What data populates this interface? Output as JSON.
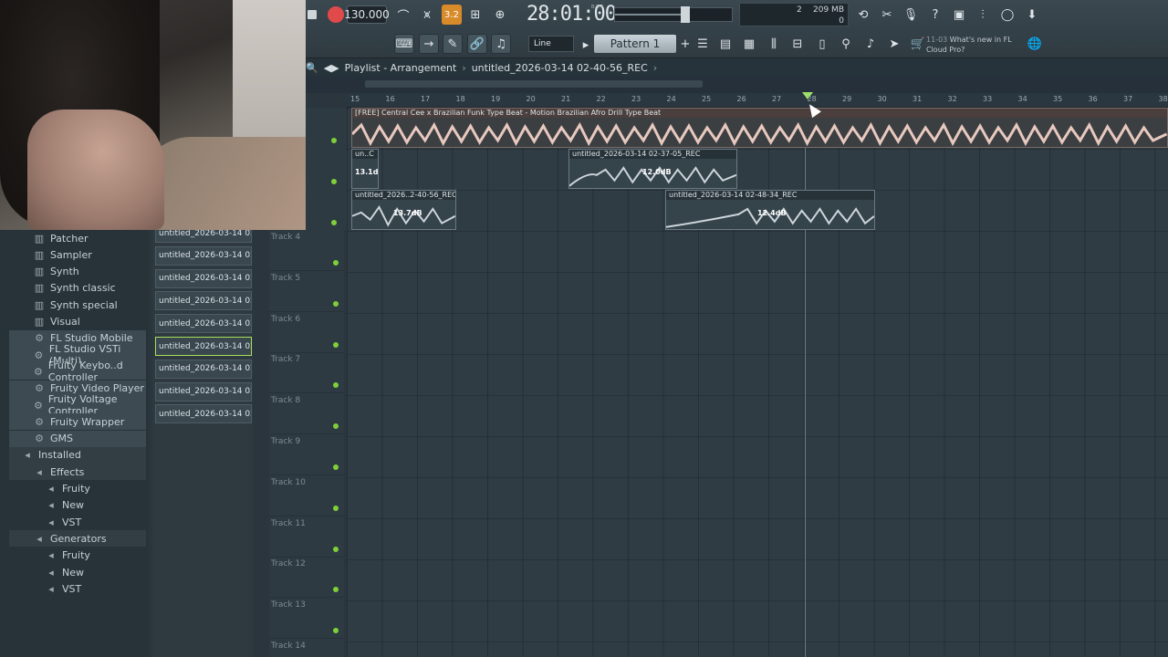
{
  "toolbar": {
    "tempo": "130.000",
    "countdown_label": "3.2",
    "time": "28:01:00",
    "time_format": "B:S:T",
    "polyphony": "2",
    "memory": "209 MB",
    "cpu": "0",
    "snap": "Line",
    "pattern": "Pattern 1",
    "news_date": "11-03",
    "news_title": "What's new in FL",
    "news_sub": "Cloud Pro?"
  },
  "playlist": {
    "title": "Playlist - Arrangement",
    "sep": "›",
    "project": "untitled_2026-03-14 02-40-56_REC",
    "sep_end": "›"
  },
  "ruler_ticks": [
    "15",
    "16",
    "17",
    "18",
    "19",
    "20",
    "21",
    "22",
    "23",
    "24",
    "25",
    "26",
    "27",
    "28",
    "29",
    "30",
    "31",
    "32",
    "33",
    "34",
    "35",
    "36",
    "37",
    "38"
  ],
  "clips": [
    {
      "name": "[FREE] Central Cee x Brazilian Funk Type Beat - Motion  Brazilian Afro Drill Type Beat",
      "db": ""
    },
    {
      "name": "un..C",
      "db": "13.1dB"
    },
    {
      "name": "untitled_2026-03-14 02-37-05_REC",
      "db": "12.0dB"
    },
    {
      "name": "untitled_2026..2-40-56_REC",
      "db": "13.7dB"
    },
    {
      "name": "untitled_2026-03-14 02-48-34_REC",
      "db": "12.4dB"
    }
  ],
  "browser_items": [
    {
      "label": "Patcher",
      "icon": "piano-icon",
      "indent": 2,
      "state": ""
    },
    {
      "label": "Sampler",
      "icon": "piano-icon",
      "indent": 2,
      "state": ""
    },
    {
      "label": "Synth",
      "icon": "piano-icon",
      "indent": 2,
      "state": ""
    },
    {
      "label": "Synth classic",
      "icon": "piano-icon",
      "indent": 2,
      "state": ""
    },
    {
      "label": "Synth special",
      "icon": "piano-icon",
      "indent": 2,
      "state": ""
    },
    {
      "label": "Visual",
      "icon": "piano-icon",
      "indent": 2,
      "state": ""
    },
    {
      "label": "FL Studio Mobile",
      "icon": "gear-icon",
      "indent": 2,
      "state": "sel"
    },
    {
      "label": "FL Studio VSTi (Multi)",
      "icon": "gear-icon",
      "indent": 2,
      "state": "sel"
    },
    {
      "label": "Fruity Keybo..d Controller",
      "icon": "gear-icon",
      "indent": 2,
      "state": "sel"
    },
    {
      "label": "Fruity Video Player",
      "icon": "gear-icon",
      "indent": 2,
      "state": "sel"
    },
    {
      "label": "Fruity Voltage Controller",
      "icon": "gear-icon",
      "indent": 2,
      "state": "sel"
    },
    {
      "label": "Fruity Wrapper",
      "icon": "gear-icon",
      "indent": 2,
      "state": "sel"
    },
    {
      "label": "GMS",
      "icon": "gear-icon",
      "indent": 2,
      "state": "sel"
    },
    {
      "label": "Installed",
      "icon": "plug-icon",
      "indent": 1,
      "state": "hl"
    },
    {
      "label": "Effects",
      "icon": "plug-icon",
      "indent": 2,
      "state": "hl"
    },
    {
      "label": "Fruity",
      "icon": "plug-icon",
      "indent": 3,
      "state": ""
    },
    {
      "label": "New",
      "icon": "plug-icon",
      "indent": 3,
      "state": ""
    },
    {
      "label": "VST",
      "icon": "plug-icon",
      "indent": 3,
      "state": ""
    },
    {
      "label": "Generators",
      "icon": "plug-icon",
      "indent": 2,
      "state": "hl"
    },
    {
      "label": "Fruity",
      "icon": "plug-icon",
      "indent": 3,
      "state": ""
    },
    {
      "label": "New",
      "icon": "plug-icon",
      "indent": 3,
      "state": ""
    },
    {
      "label": "VST",
      "icon": "plug-icon",
      "indent": 3,
      "state": ""
    }
  ],
  "recent_files": [
    {
      "label": "untitled_2026-03-14 02-...",
      "selected": false
    },
    {
      "label": "untitled_2026-03-14 02-...",
      "selected": false
    },
    {
      "label": "untitled_2026-03-14 02-...",
      "selected": false
    },
    {
      "label": "untitled_2026-03-14 02-...",
      "selected": false
    },
    {
      "label": "untitled_2026-03-14 02-...",
      "selected": false
    },
    {
      "label": "untitled_2026-03-14 02-...",
      "selected": true
    },
    {
      "label": "untitled_2026-03-14 02-...",
      "selected": false
    },
    {
      "label": "untitled_2026-03-14 02-...",
      "selected": false
    },
    {
      "label": "untitled_2026-03-14 02-...",
      "selected": false
    }
  ],
  "tracks": [
    "Track 4",
    "Track 5",
    "Track 6",
    "Track 7",
    "Track 8",
    "Track 9",
    "Track 10",
    "Track 11",
    "Track 12",
    "Track 13",
    "Track 14"
  ]
}
